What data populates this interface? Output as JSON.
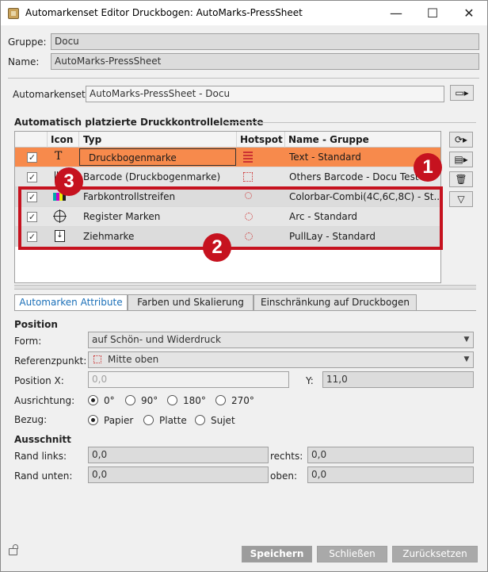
{
  "window": {
    "title": "Automarkenset Editor Druckbogen: AutoMarks-PressSheet",
    "minimize": "—",
    "maximize": "☐",
    "close": "✕"
  },
  "header": {
    "gruppe_label": "Gruppe:",
    "gruppe_value": "Docu",
    "name_label": "Name:",
    "name_value": "AutoMarks-PressSheet",
    "set_label": "Automarkenset:",
    "set_value": "AutoMarks-PressSheet - Docu"
  },
  "table": {
    "section_title": "Automatisch platzierte Druckkontrollelemente",
    "columns": [
      "Icon",
      "Typ",
      "Hotspot",
      "Name - Gruppe"
    ],
    "rows": [
      {
        "checked": true,
        "icon": "T",
        "typ": "Druckbogenmarke",
        "name": "Text - Standard",
        "selected": true
      },
      {
        "checked": true,
        "icon": "barcode-icon",
        "typ": "Barcode (Druckbogenmarke)",
        "name": "Others Barcode - Docu Test",
        "selected": false
      },
      {
        "checked": true,
        "icon": "colorbar-icon",
        "typ": "Farbkontrollstreifen",
        "name": "Colorbar-Combi(4C,6C,8C) - St...",
        "selected": false
      },
      {
        "checked": true,
        "icon": "register-icon",
        "typ": "Register Marken",
        "name": "Arc - Standard",
        "selected": false
      },
      {
        "checked": true,
        "icon": "pull-icon",
        "typ": "Ziehmarke",
        "name": "PullLay - Standard",
        "selected": false
      }
    ]
  },
  "tabs": [
    "Automarken Attribute",
    "Farben und Skalierung",
    "Einschränkung auf Druckbogen"
  ],
  "position": {
    "title": "Position",
    "form_label": "Form:",
    "form_value": "auf Schön- und Widerdruck",
    "ref_label": "Referenzpunkt:",
    "ref_value": "Mitte oben",
    "x_label": "Position X:",
    "x_value": "0,0",
    "y_label": "Y:",
    "y_value": "11,0",
    "ausrichtung_label": "Ausrichtung:",
    "ausrichtung_options": [
      "0°",
      "90°",
      "180°",
      "270°"
    ],
    "bezug_label": "Bezug:",
    "bezug_options": [
      "Papier",
      "Platte",
      "Sujet"
    ]
  },
  "ausschnitt": {
    "title": "Ausschnitt",
    "links_label": "Rand links:",
    "links_value": "0,0",
    "rechts_label": "rechts:",
    "rechts_value": "0,0",
    "unten_label": "Rand unten:",
    "unten_value": "0,0",
    "oben_label": "oben:",
    "oben_value": "0,0"
  },
  "buttons": {
    "save": "Speichern",
    "close": "Schließen",
    "reset": "Zurücksetzen"
  },
  "callouts": [
    "1",
    "2",
    "3"
  ],
  "colors": {
    "selected_row": "#f78a4c",
    "callout": "#c6121f",
    "tab_active_text": "#1a6fb8"
  }
}
